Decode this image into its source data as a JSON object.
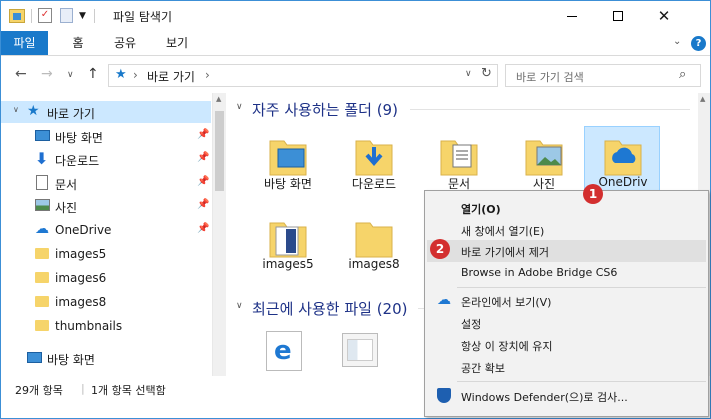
{
  "window": {
    "title": "파일 탐색기"
  },
  "ribbon": {
    "tabs": [
      "파일",
      "홈",
      "공유",
      "보기"
    ]
  },
  "address": {
    "crumbs": [
      "바로 가기"
    ],
    "search_placeholder": "바로 가기 검색"
  },
  "navpane": {
    "items": [
      {
        "label": "바로 가기",
        "icon": "star-icon",
        "pinned": false,
        "selected": true
      },
      {
        "label": "바탕 화면",
        "icon": "desktop-icon",
        "pinned": true
      },
      {
        "label": "다운로드",
        "icon": "download-icon",
        "pinned": true
      },
      {
        "label": "문서",
        "icon": "document-icon",
        "pinned": true
      },
      {
        "label": "사진",
        "icon": "picture-icon",
        "pinned": true
      },
      {
        "label": "OneDrive",
        "icon": "onedrive-icon",
        "pinned": true
      },
      {
        "label": "images5",
        "icon": "folder-icon",
        "pinned": false
      },
      {
        "label": "images6",
        "icon": "folder-icon",
        "pinned": false
      },
      {
        "label": "images8",
        "icon": "folder-icon",
        "pinned": false
      },
      {
        "label": "thumbnails",
        "icon": "folder-icon",
        "pinned": false
      },
      {
        "label": "바탕 화면",
        "icon": "desktop-icon",
        "pinned": false
      }
    ]
  },
  "content": {
    "frequent_title": "자주 사용하는 폴더 (9)",
    "recent_title": "최근에 사용한 파일 (20)",
    "folders_row1": [
      "바탕 화면",
      "다운로드",
      "문서",
      "사진",
      "OneDriv"
    ],
    "folders_row2": [
      "images5",
      "images8"
    ]
  },
  "status": {
    "count": "29개 항목",
    "selected": "1개 항목 선택함"
  },
  "context_menu": {
    "items": [
      "열기(O)",
      "새 창에서 열기(E)",
      "바로 가기에서 제거",
      "Browse in Adobe Bridge CS6",
      "온라인에서 보기(V)",
      "설정",
      "항상 이 장치에 유지",
      "공간 확보",
      "Windows Defender(으)로 검사..."
    ],
    "badges": [
      "1",
      "2"
    ]
  },
  "colors": {
    "accent": "#1979ca",
    "selection": "#cce8ff",
    "badge": "#d32f2f",
    "folder": "#f6d46a"
  }
}
